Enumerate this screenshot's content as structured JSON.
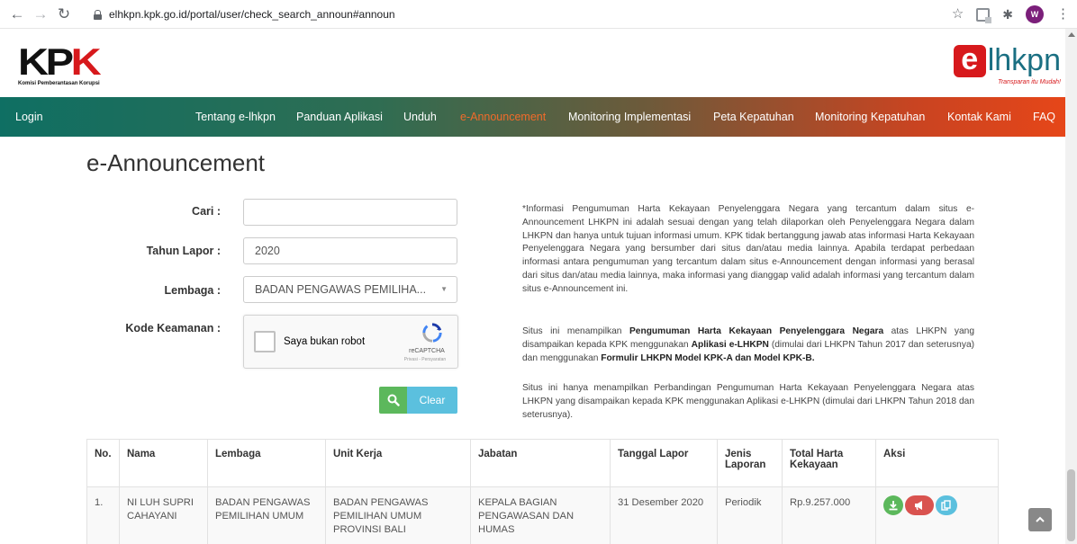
{
  "browser": {
    "url": "elhkpn.kpk.go.id/portal/user/check_search_announ#announ",
    "avatar_initial": "W",
    "icons": [
      "back-icon",
      "forward-icon",
      "reload-icon",
      "lock-icon",
      "star-icon",
      "extension-icon",
      "puzzle-icon",
      "menu-icon"
    ]
  },
  "header": {
    "kpk_logo_left": "KP",
    "kpk_logo_right": "K",
    "kpk_subtitle": "Komisi Pemberantasan Korupsi",
    "elhkpn_e": "e",
    "elhkpn_text": "lhkpn",
    "elhkpn_tagline": "Transparan itu Mudah!"
  },
  "nav": {
    "login": "Login",
    "items": [
      {
        "label": "Tentang e-lhkpn"
      },
      {
        "label": "Panduan Aplikasi"
      },
      {
        "label": "Unduh"
      },
      {
        "label": "e-Announcement"
      },
      {
        "label": "Monitoring Implementasi"
      },
      {
        "label": "Peta Kepatuhan"
      },
      {
        "label": "Monitoring Kepatuhan"
      },
      {
        "label": "Kontak Kami"
      },
      {
        "label": "FAQ"
      }
    ],
    "active_color": "#f26b2a"
  },
  "main": {
    "title": "e-Announcement",
    "form": {
      "cari_label": "Cari :",
      "cari_value": "",
      "tahun_label": "Tahun Lapor :",
      "tahun_value": "2020",
      "lembaga_label": "Lembaga :",
      "lembaga_value": "BADAN PENGAWAS PEMILIHA...",
      "kode_label": "Kode Keamanan :",
      "captcha_text": "Saya bukan robot",
      "captcha_brand": "reCAPTCHA",
      "captcha_terms": "Privasi - Persyaratan",
      "clear_label": "Clear"
    },
    "info": {
      "p1": "*Informasi Pengumuman Harta Kekayaan Penyelenggara Negara yang tercantum dalam situs e-Announcement LHKPN ini adalah sesuai dengan yang telah dilaporkan oleh Penyelenggara Negara dalam LHKPN dan hanya untuk tujuan informasi umum. KPK tidak bertanggung jawab atas informasi Harta Kekayaan Penyelenggara Negara yang bersumber dari situs dan/atau media lainnya. Apabila terdapat perbedaan informasi antara pengumuman yang tercantum dalam situs e-Announcement dengan informasi yang berasal dari situs dan/atau media lainnya, maka informasi yang dianggap valid adalah informasi yang tercantum dalam situs e-Announcement ini.",
      "p2_a": "Situs ini menampilkan ",
      "p2_b": "Pengumuman Harta Kekayaan Penyelenggara Negara",
      "p2_c": " atas LHKPN yang disampaikan kepada KPK menggunakan ",
      "p2_d": "Aplikasi e-LHKPN",
      "p2_e": " (dimulai dari LHKPN Tahun 2017 dan seterusnya) dan menggunakan ",
      "p2_f": "Formulir LHKPN Model KPK-A dan Model KPK-B.",
      "p3": "Situs ini hanya menampilkan Perbandingan Pengumuman Harta Kekayaan Penyelenggara Negara atas LHKPN yang disampaikan kepada KPK menggunakan Aplikasi e-LHKPN (dimulai dari LHKPN Tahun 2018 dan seterusnya)."
    },
    "table": {
      "headers": {
        "no": "No.",
        "nama": "Nama",
        "lembaga": "Lembaga",
        "unit": "Unit Kerja",
        "jabatan": "Jabatan",
        "tanggal": "Tanggal Lapor",
        "jenis": "Jenis Laporan",
        "total": "Total Harta Kekayaan",
        "aksi": "Aksi"
      },
      "rows": [
        {
          "no": "1.",
          "nama": "NI LUH SUPRI CAHAYANI",
          "lembaga": "BADAN PENGAWAS PEMILIHAN UMUM",
          "unit": "BADAN PENGAWAS PEMILIHAN UMUM PROVINSI BALI",
          "jabatan": "KEPALA BAGIAN PENGAWASAN DAN HUMAS",
          "tanggal": "31 Desember 2020",
          "jenis": "Periodik",
          "total": "Rp.9.257.000"
        }
      ]
    }
  },
  "colors": {
    "green": "#5cb85c",
    "red": "#d9534f",
    "cyan": "#5bc0de",
    "kpk_red": "#d7191c",
    "teal": "#1a6f82"
  }
}
